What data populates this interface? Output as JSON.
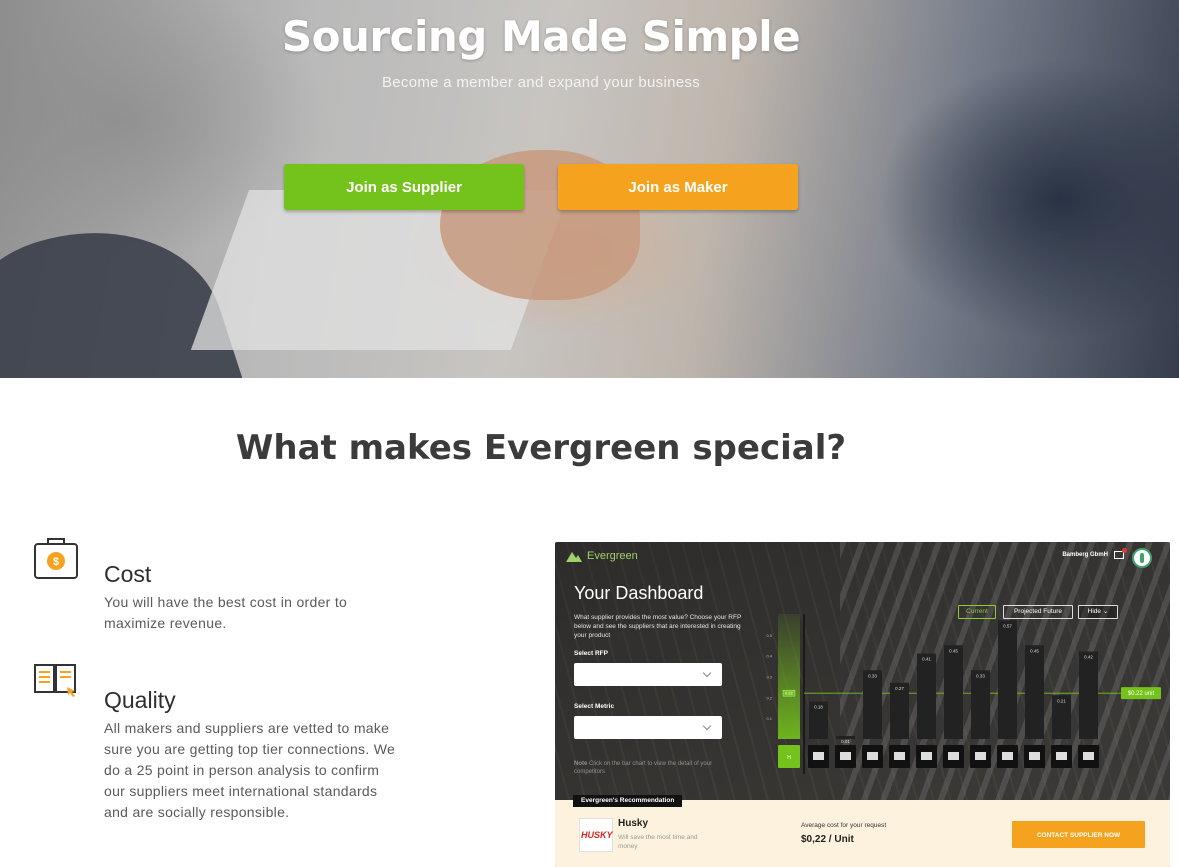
{
  "hero": {
    "title": "Sourcing Made Simple",
    "subtitle": "Become a member and expand your business",
    "supplier_button": "Join as Supplier",
    "maker_button": "Join as Maker"
  },
  "section": {
    "title": "What makes Evergreen special?",
    "features": [
      {
        "title": "Cost",
        "text": "You will have the best cost in order to maximize revenue.",
        "icon": "bag-dollar-icon"
      },
      {
        "title": "Quality",
        "text": "All makers and suppliers are vetted to make sure you are getting top tier connections. We do a 25 point in person analysis to confirm our suppliers meet international standards and are socially responsible.",
        "icon": "open-book-icon"
      }
    ]
  },
  "dashboard": {
    "brand": "Evergreen",
    "company": "Bamberg GbmH",
    "heading": "Your Dashboard",
    "description": "What supplier provides the most value? Choose your RFP below and see the suppliers that are interested in creating your product",
    "rfp_label": "Select RFP",
    "metric_label": "Select Metric",
    "note_bold": "Note",
    "note_text": "Click on the bar chart to view the detail of your competitors",
    "toggles": [
      "Current",
      "Projected Future",
      "Hide"
    ],
    "recommendation_tag": "Evergreen's Recommendation",
    "supplier_name": "Husky",
    "supplier_logo_text": "HUSKY",
    "supplier_desc": "Will save the most time and money",
    "avg_cost_label": "Average cost for your request",
    "avg_cost_value": "$0,22 / Unit",
    "contact_button": "CONTACT SUPPLIER NOW"
  },
  "chart_data": {
    "type": "bar",
    "categories": [
      "US",
      "GB",
      "TR",
      "RU",
      "NG",
      "IT",
      "JP",
      "IN",
      "FR",
      "DE",
      "AU"
    ],
    "values": [
      0.18,
      0.01,
      0.33,
      0.27,
      0.41,
      0.45,
      0.33,
      0.57,
      0.45,
      0.21,
      0.42
    ],
    "highlight": {
      "label": "H",
      "value": 0.22
    },
    "reference_line": {
      "value": 0.22,
      "label": "$0.22 unit"
    },
    "ylim": [
      0,
      0.6
    ],
    "colors": {
      "bars": "#222222",
      "highlight": "#74c21c",
      "reference": "#74c21c"
    }
  },
  "colors": {
    "accent_green": "#74c21c",
    "accent_orange": "#f5a31f",
    "heading": "#3b3b3b"
  }
}
